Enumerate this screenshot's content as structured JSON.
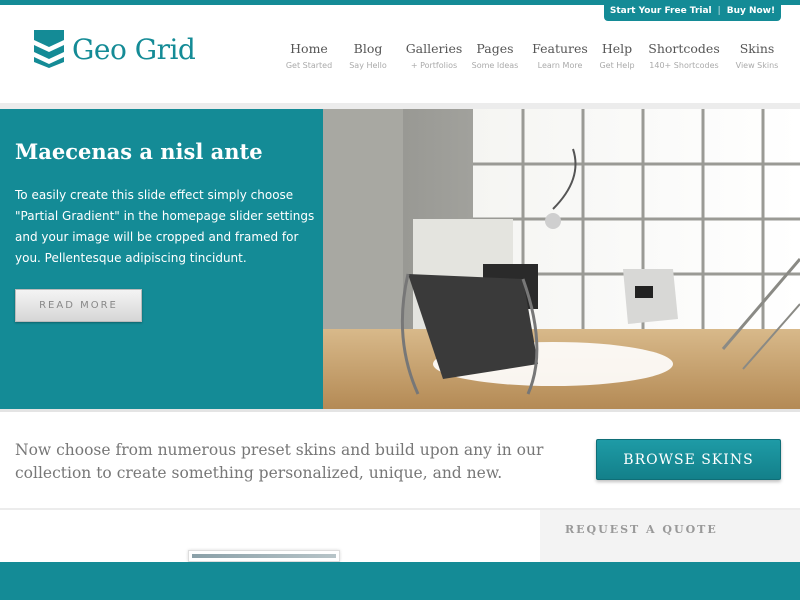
{
  "top_links": {
    "trial_label": "Start Your Free Trial",
    "separator": "|",
    "buy_label": "Buy Now!"
  },
  "brand": {
    "name": "Geo Grid",
    "accent_color": "#148b96"
  },
  "nav": {
    "items": [
      {
        "label": "Home",
        "sub": "Get Started"
      },
      {
        "label": "Blog",
        "sub": "Say Hello"
      },
      {
        "label": "Galleries",
        "sub": "+ Portfolios"
      },
      {
        "label": "Pages",
        "sub": "Some Ideas"
      },
      {
        "label": "Features",
        "sub": "Learn More"
      },
      {
        "label": "Help",
        "sub": "Get Help"
      },
      {
        "label": "Shortcodes",
        "sub": "140+ Shortcodes"
      },
      {
        "label": "Skins",
        "sub": "View Skins"
      }
    ]
  },
  "slider": {
    "title": "Maecenas a nisl ante",
    "text": "To easily create this slide effect simply choose \"Partial Gradient\" in the homepage slider settings and your image will be cropped and framed for you. Pellentesque adipiscing tincidunt.",
    "button_label": "READ MORE",
    "image_icon": "interior-photo"
  },
  "promo": {
    "text": "Now choose from numerous preset skins and build upon any in our collection to create something personalized, unique, and new.",
    "button_label": "BROWSE SKINS"
  },
  "sidebar": {
    "quote_title": "REQUEST A QUOTE"
  }
}
